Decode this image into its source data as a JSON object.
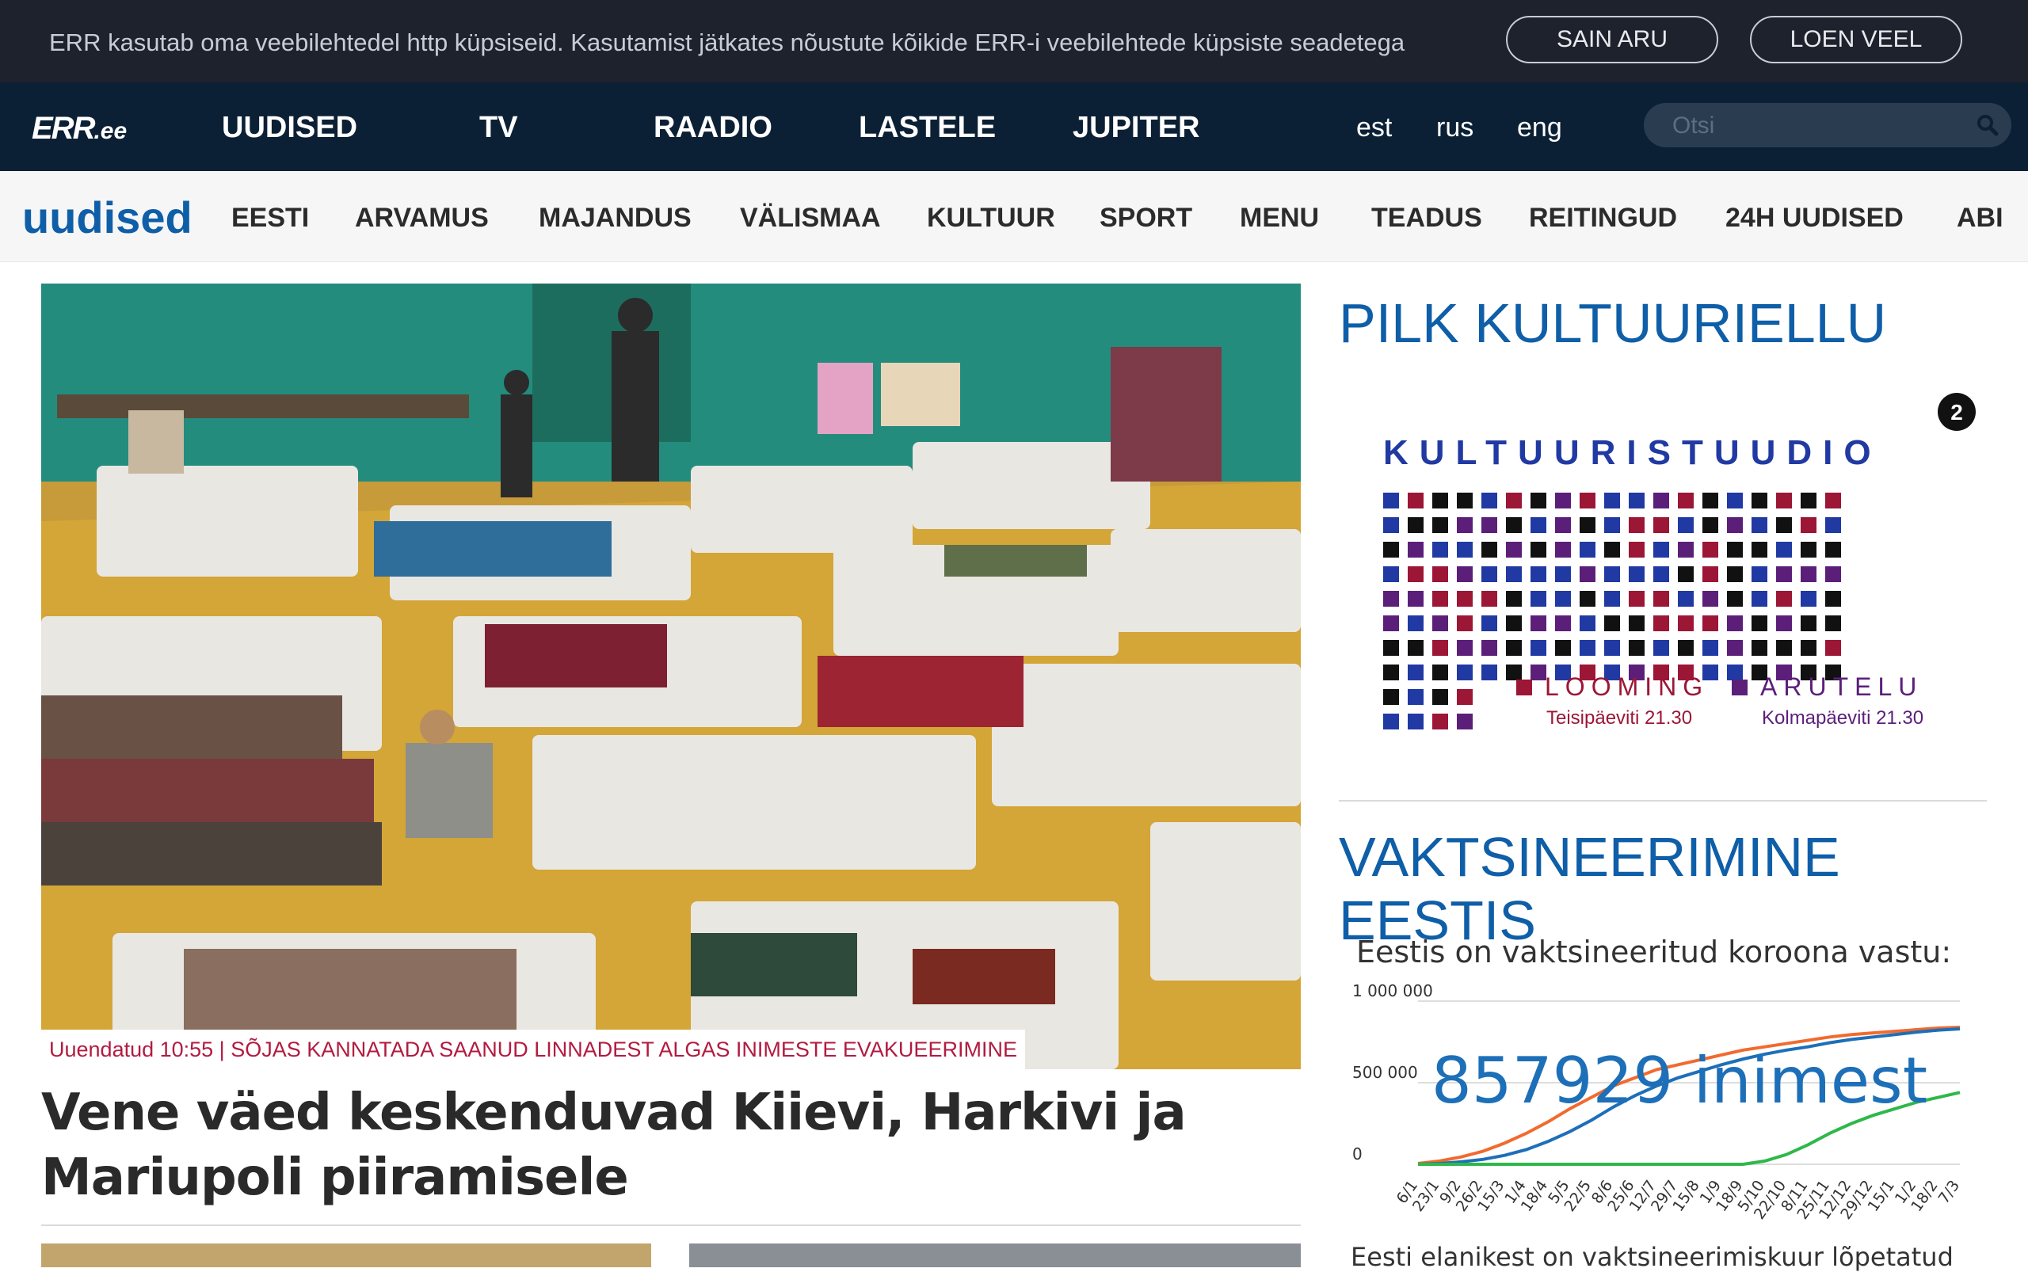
{
  "cookie": {
    "text": "ERR kasutab oma veebilehtedel http küpsiseid. Kasutamist jätkates nõustute kõikide ERR-i veebilehtede küpsiste seadetega",
    "ok_label": "SAIN ARU",
    "more_label": "LOEN VEEL"
  },
  "topnav": {
    "logo_main": "ERR",
    "logo_suffix": ".ee",
    "items": [
      "UUDISED",
      "TV",
      "RAADIO",
      "LASTELE",
      "JUPITER"
    ],
    "langs": [
      "est",
      "rus",
      "eng"
    ],
    "search_placeholder": "Otsi"
  },
  "secnav": {
    "title": "uudised",
    "items": [
      "EESTI",
      "ARVAMUS",
      "MAJANDUS",
      "VÄLISMAA",
      "KULTUUR",
      "SPORT",
      "MENU",
      "TEADUS",
      "REITINGUD",
      "24H UUDISED",
      "ABI"
    ]
  },
  "hero": {
    "kicker": "Uuendatud 10:55 | SÕJAS KANNATADA SAANUD LINNADEST ALGAS INIMESTE EVAKUEERIMINE",
    "headline": "Vene väed keskenduvad Kiievi, Harkivi ja Mariupoli piiramisele"
  },
  "right": {
    "promo_heading": "PILK KULTUURIELLU",
    "promo": {
      "title": "KULTUURISTUUDIO",
      "badge": "2",
      "show1": "LOOMING",
      "show1_time": "Teisipäeviti 21.30",
      "show2": "ARUTELU",
      "show2_time": "Kolmapäeviti 21.30"
    },
    "vax_heading": "VAKTSINEERIMINE EESTIS",
    "vax_sub": "Eestis on vaktsineeritud koroona vastu:",
    "vax_count": "857929 inimest",
    "vax_bottom": "Eesti elanikest on vaktsineerimiskuur lõpetatud"
  },
  "chart_data": {
    "type": "line",
    "ylim": [
      0,
      1000000
    ],
    "yticks": [
      "1 000 000",
      "500 000",
      "0"
    ],
    "x": [
      "6/1",
      "23/1",
      "9/2",
      "26/2",
      "15/3",
      "1/4",
      "18/4",
      "5/5",
      "22/5",
      "8/6",
      "25/6",
      "12/7",
      "29/7",
      "15/8",
      "1/9",
      "18/9",
      "5/10",
      "22/10",
      "8/11",
      "25/11",
      "12/12",
      "29/12",
      "15/1",
      "1/2",
      "18/2",
      "7/3"
    ],
    "series": [
      {
        "color": "#f26a2e",
        "values": [
          5000,
          20000,
          45000,
          80000,
          130000,
          190000,
          260000,
          340000,
          410000,
          480000,
          530000,
          580000,
          610000,
          640000,
          670000,
          700000,
          720000,
          740000,
          760000,
          780000,
          795000,
          805000,
          815000,
          825000,
          835000,
          840000
        ]
      },
      {
        "color": "#1d6fb8",
        "values": [
          0,
          5000,
          15000,
          30000,
          55000,
          90000,
          140000,
          200000,
          270000,
          350000,
          420000,
          480000,
          530000,
          570000,
          610000,
          645000,
          675000,
          700000,
          720000,
          745000,
          765000,
          780000,
          795000,
          810000,
          822000,
          830000
        ]
      },
      {
        "color": "#2fb84a",
        "values": [
          0,
          0,
          0,
          0,
          0,
          0,
          0,
          0,
          0,
          0,
          0,
          0,
          0,
          0,
          0,
          0,
          20000,
          60000,
          120000,
          190000,
          250000,
          300000,
          340000,
          380000,
          410000,
          440000
        ]
      }
    ]
  }
}
